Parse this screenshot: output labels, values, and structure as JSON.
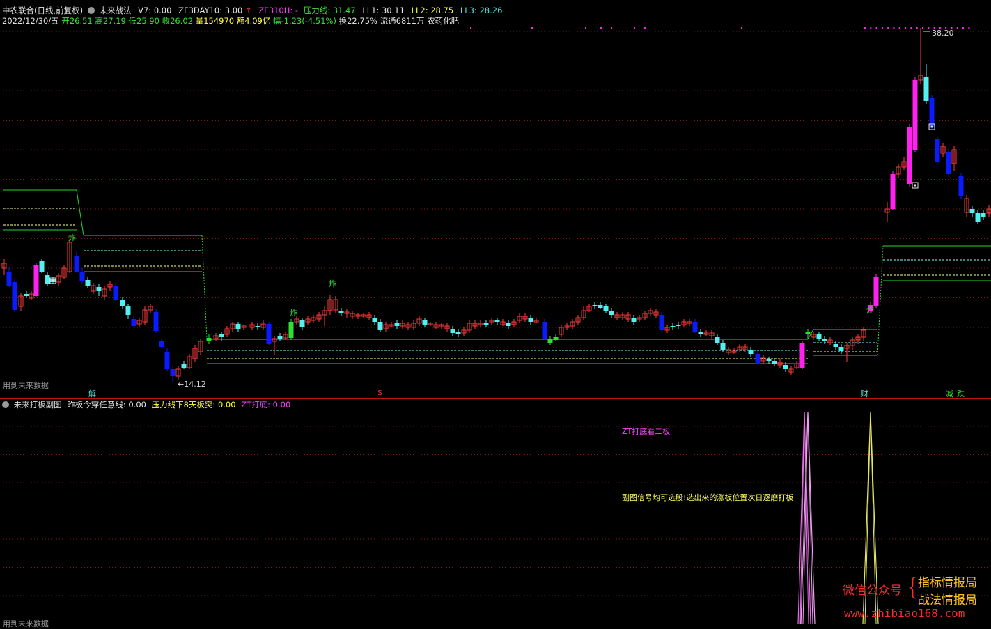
{
  "header": {
    "stock_name": "中农联合(日线,前复权)",
    "indicator_name": "未来战法",
    "v7": "V7: 0.00",
    "zf3day10": "ZF3DAY10: 3.00",
    "zf310h": "ZF310H: -",
    "pressure_line": "压力线: 31.47",
    "ll1": "LL1: 30.11",
    "ll2": "LL2: 28.75",
    "ll3": "LL3: 28.26"
  },
  "quote": {
    "date": "2022/12/30/五",
    "open": "开26.51",
    "high": "高27.19",
    "low": "低25.90",
    "close": "收26.02",
    "volume": "量154970",
    "amount": "额4.09亿",
    "change": "幅-1.23(-4.51%)",
    "turnover": "换22.75%",
    "float": "流通6811万",
    "sector": "农药化肥"
  },
  "main_chart": {
    "max_label": "38.20",
    "min_label": "←14.12",
    "future_data_text": "用到未来数据",
    "signals": [
      "炸",
      "炸",
      "炸",
      "炸"
    ],
    "markers": [
      "解",
      "$",
      "财",
      "减",
      "跌"
    ]
  },
  "sub_chart": {
    "title": "未来打板副图",
    "line1": "昨板今穿任意线: 0.00",
    "line2": "压力线下8天板突: 0.00",
    "line3": "ZT打底: 0.00",
    "note1": "ZT打底看二板",
    "note2": "副图信号均可选股!选出来的涨板位置次日逐磨打板",
    "future_data_text": "用到未来数据"
  },
  "watermark": {
    "wechat": "微信公众号",
    "name1": "指标情报局",
    "name2": "战法情报局",
    "site": "www.zhibiao168.com"
  },
  "colors": {
    "up": "#ff3b3b",
    "down_cyan": "#54f0f0",
    "down_blue": "#0a1cff",
    "zt_magenta": "#ff22ee",
    "green_line": "#28d628",
    "grid": "#7a1a1a"
  }
}
